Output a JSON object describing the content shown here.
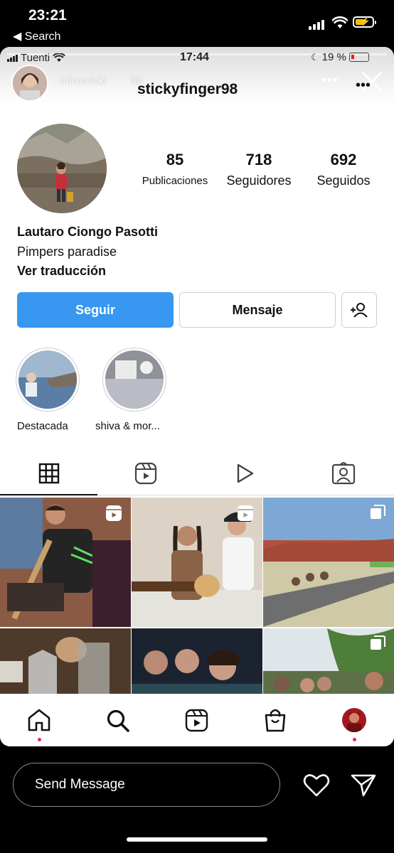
{
  "outer_status": {
    "time": "23:21",
    "back_label": "◀ Search"
  },
  "inner_status": {
    "carrier": "Tuenti",
    "time": "17:44",
    "battery": "19 %"
  },
  "story": {
    "username": "micumicki",
    "time": "5h",
    "more": "•••"
  },
  "profile": {
    "username": "stickyfinger98",
    "more": "•••",
    "stats": [
      {
        "value": "85",
        "label": "Publicaciones"
      },
      {
        "value": "718",
        "label": "Seguidores"
      },
      {
        "value": "692",
        "label": "Seguidos"
      }
    ],
    "name": "Lautaro Ciongo Pasotti",
    "bio": "Pimpers paradise",
    "translate": "Ver traducción",
    "follow_label": "Seguir",
    "message_label": "Mensaje",
    "highlights": [
      {
        "label": "Destacada"
      },
      {
        "label": "shiva & mor..."
      }
    ]
  },
  "reply": {
    "placeholder": "Send Message"
  },
  "colors": {
    "follow": "#3897f0",
    "notification_dot": "#e0245e"
  },
  "icons": [
    "grid-icon",
    "reels-icon",
    "play-icon",
    "tagged-icon",
    "home-icon",
    "search-icon",
    "reels-icon",
    "shop-icon",
    "heart-icon",
    "send-icon",
    "add-person-icon",
    "close-icon"
  ]
}
